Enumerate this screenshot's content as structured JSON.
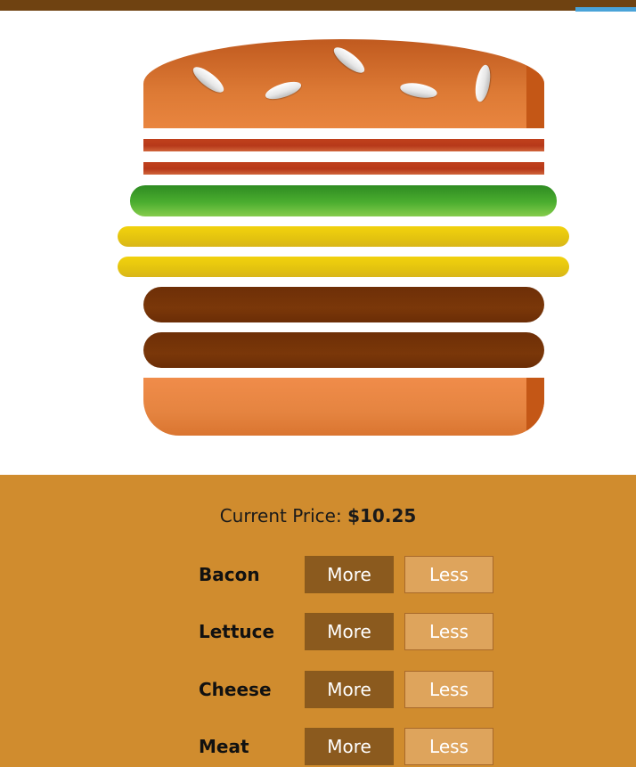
{
  "controls": {
    "price_label": "Current Price:",
    "price_value": "$10.25",
    "more_label": "More",
    "less_label": "Less",
    "ingredients": [
      {
        "label": "Bacon"
      },
      {
        "label": "Lettuce"
      },
      {
        "label": "Cheese"
      },
      {
        "label": "Meat"
      }
    ]
  }
}
